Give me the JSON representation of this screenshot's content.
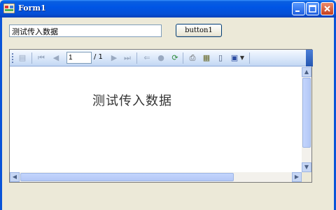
{
  "window": {
    "title": "Form1",
    "minimize_glyph": "–",
    "maximize_glyph": "□",
    "close_glyph": "✕",
    "accent": "#0055e5"
  },
  "form": {
    "textbox_value": "测试传入数据",
    "button_label": "button1"
  },
  "report_viewer": {
    "toolbar": {
      "icons": [
        "document-map-icon",
        "first-page-icon",
        "previous-page-icon",
        "next-page-icon",
        "last-page-icon",
        "back-icon",
        "stop-icon",
        "refresh-icon",
        "print-icon",
        "print-layout-icon",
        "page-setup-icon",
        "export-icon"
      ],
      "current_page": "1",
      "page_total": "/ 1"
    },
    "content_text": "测试传入数据"
  }
}
